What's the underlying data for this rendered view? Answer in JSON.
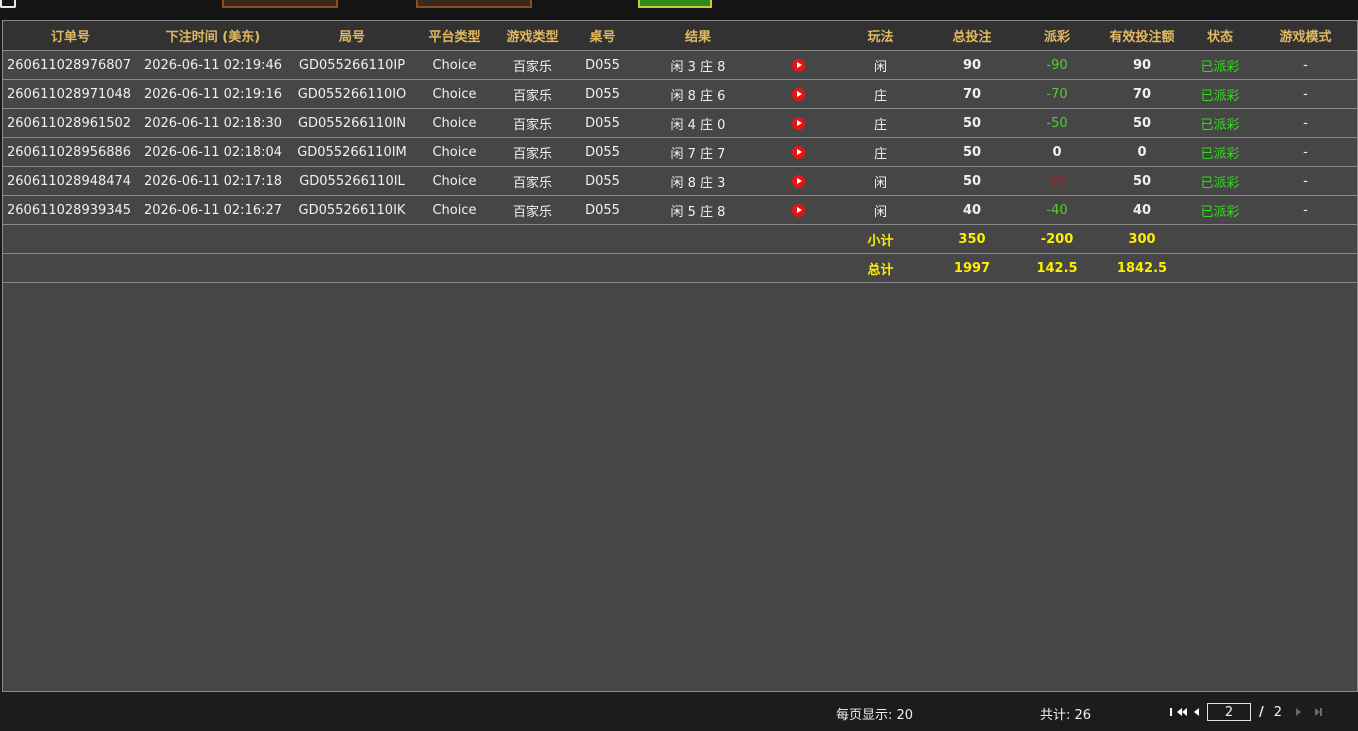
{
  "columns": [
    "订单号",
    "下注时间 (美东)",
    "局号",
    "平台类型",
    "游戏类型",
    "桌号",
    "结果",
    "",
    "玩法",
    "总投注",
    "派彩",
    "有效投注额",
    "状态",
    "游戏模式"
  ],
  "rows": [
    {
      "order": "260611028976807",
      "time": "2026-06-11 02:19:46",
      "round": "GD055266110IP",
      "platform": "Choice",
      "game": "百家乐",
      "table": "D055",
      "result": "闲 3 庄 8",
      "play": "闲",
      "bet": "90",
      "payout": "-90",
      "payout_color": "green",
      "valid": "90",
      "status": "已派彩",
      "mode": "-"
    },
    {
      "order": "260611028971048",
      "time": "2026-06-11 02:19:16",
      "round": "GD055266110IO",
      "platform": "Choice",
      "game": "百家乐",
      "table": "D055",
      "result": "闲 8 庄 6",
      "play": "庄",
      "bet": "70",
      "payout": "-70",
      "payout_color": "green",
      "valid": "70",
      "status": "已派彩",
      "mode": "-"
    },
    {
      "order": "260611028961502",
      "time": "2026-06-11 02:18:30",
      "round": "GD055266110IN",
      "platform": "Choice",
      "game": "百家乐",
      "table": "D055",
      "result": "闲 4 庄 0",
      "play": "庄",
      "bet": "50",
      "payout": "-50",
      "payout_color": "green",
      "valid": "50",
      "status": "已派彩",
      "mode": "-"
    },
    {
      "order": "260611028956886",
      "time": "2026-06-11 02:18:04",
      "round": "GD055266110IM",
      "platform": "Choice",
      "game": "百家乐",
      "table": "D055",
      "result": "闲 7 庄 7",
      "play": "庄",
      "bet": "50",
      "payout": "0",
      "payout_color": "white",
      "valid": "0",
      "status": "已派彩",
      "mode": "-"
    },
    {
      "order": "260611028948474",
      "time": "2026-06-11 02:17:18",
      "round": "GD055266110IL",
      "platform": "Choice",
      "game": "百家乐",
      "table": "D055",
      "result": "闲 8 庄 3",
      "play": "闲",
      "bet": "50",
      "payout": "50",
      "payout_color": "red",
      "valid": "50",
      "status": "已派彩",
      "mode": "-"
    },
    {
      "order": "260611028939345",
      "time": "2026-06-11 02:16:27",
      "round": "GD055266110IK",
      "platform": "Choice",
      "game": "百家乐",
      "table": "D055",
      "result": "闲 5 庄 8",
      "play": "闲",
      "bet": "40",
      "payout": "-40",
      "payout_color": "green",
      "valid": "40",
      "status": "已派彩",
      "mode": "-"
    }
  ],
  "subtotal": {
    "label": "小计",
    "bet": "350",
    "payout": "-200",
    "valid": "300"
  },
  "total": {
    "label": "总计",
    "bet": "1997",
    "payout": "142.5",
    "valid": "1842.5"
  },
  "footer": {
    "per_page": "每页显示: 20",
    "total_count": "共计: 26",
    "current_page": "2",
    "separator": "/",
    "total_pages": "2"
  },
  "colors": {
    "header_text": "#e2b860",
    "sum_text": "#ffee00",
    "status_text": "#35d81f",
    "loss_text": "#4fd027",
    "win_text": "#a8202a",
    "play_icon": "#e51515"
  },
  "icons": {
    "replay": "play-circle-icon",
    "first": "first-page-icon",
    "prev": "prev-page-icon",
    "next": "next-page-icon",
    "last": "last-page-icon"
  }
}
